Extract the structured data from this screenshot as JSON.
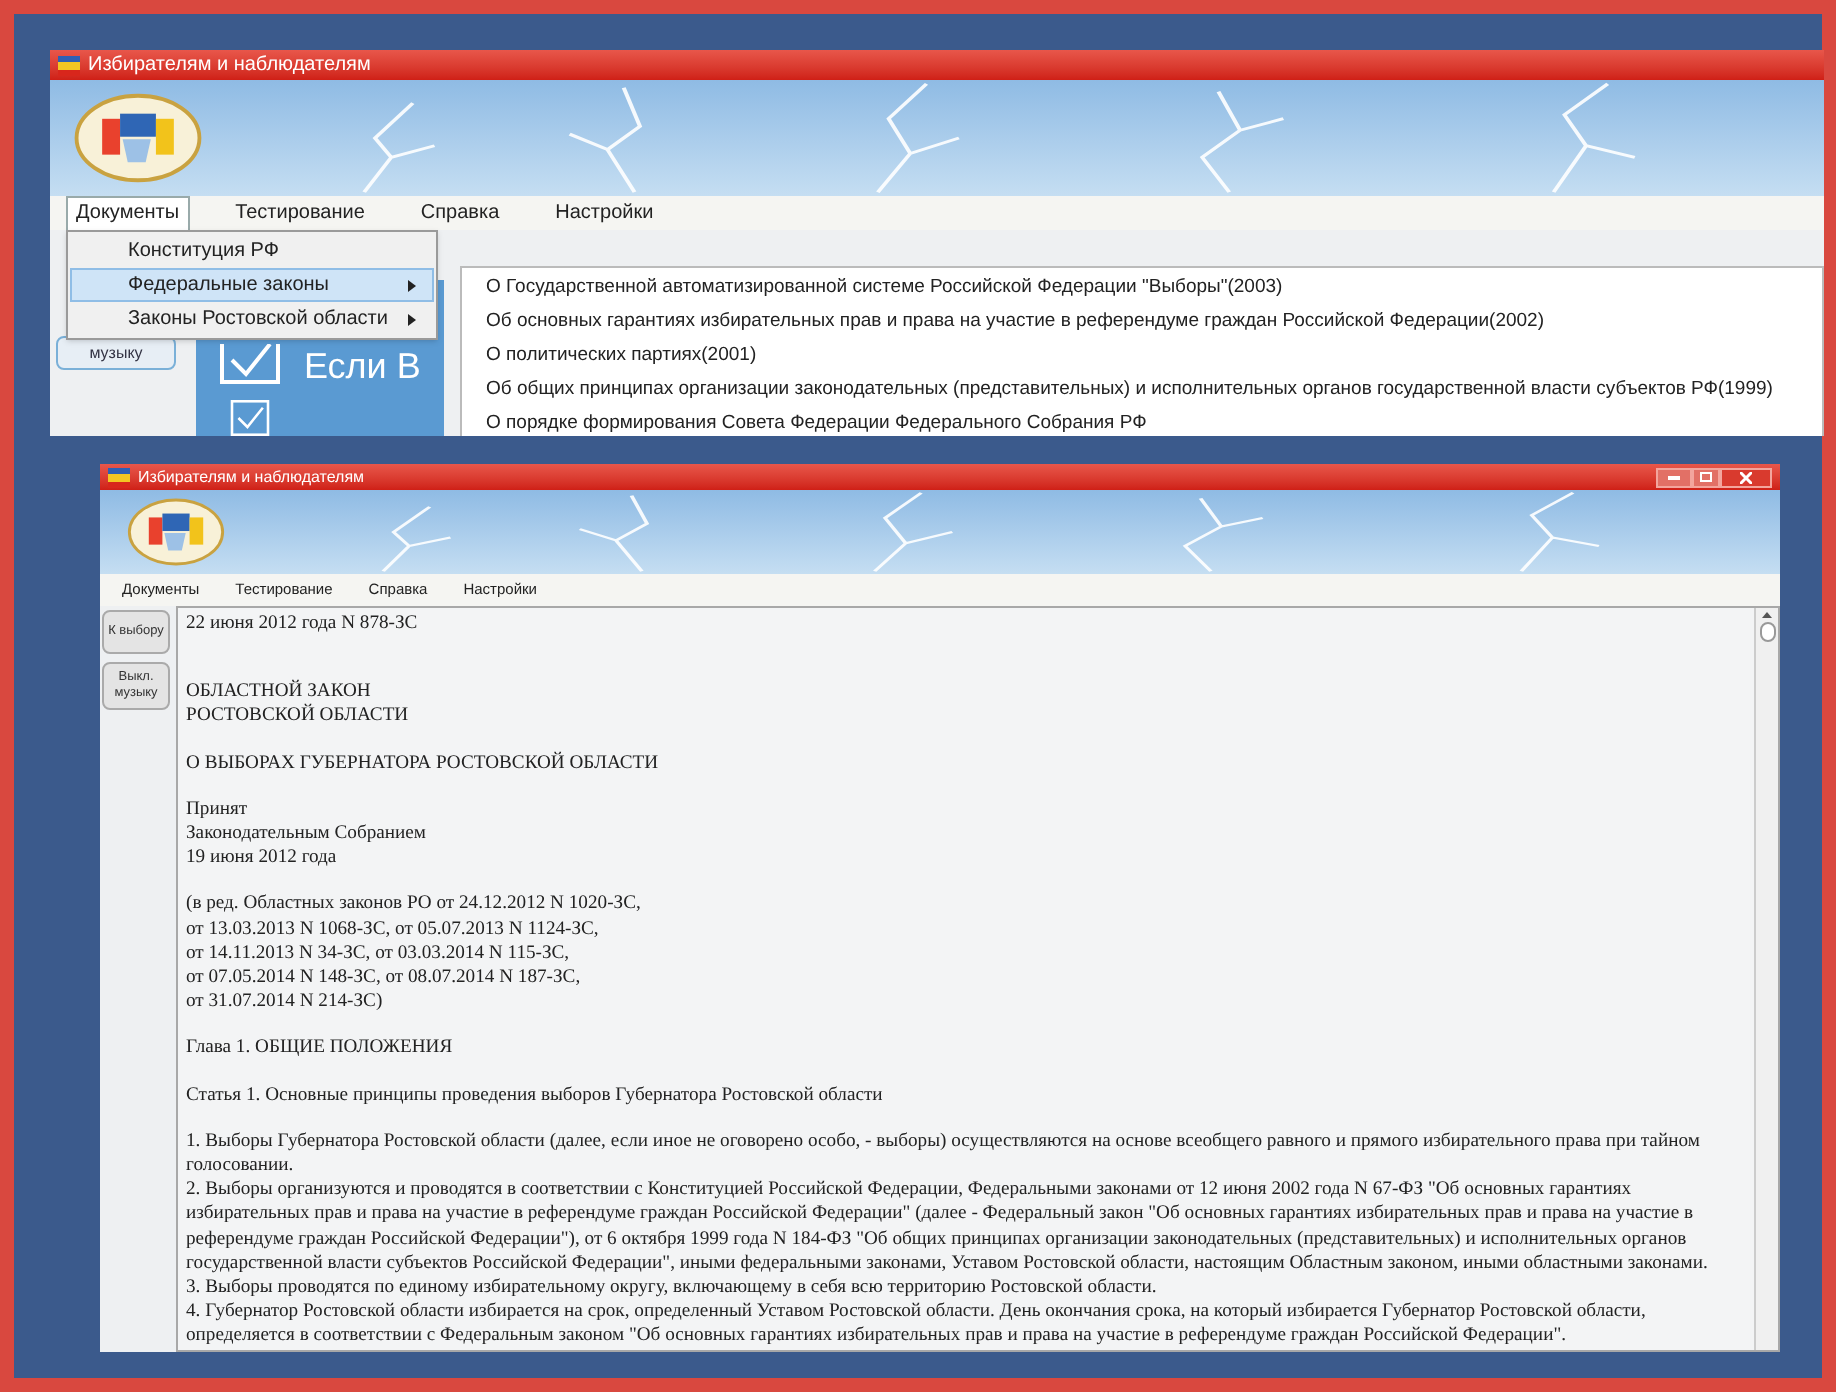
{
  "top_window": {
    "title": "Избирателям и наблюдателям",
    "menu": [
      {
        "label": "Документы",
        "selected": true
      },
      {
        "label": "Тестирование",
        "selected": false
      },
      {
        "label": "Справка",
        "selected": false
      },
      {
        "label": "Настройки",
        "selected": false
      }
    ],
    "side_button": "музыку",
    "panel_text": "Если В",
    "dropdown": [
      {
        "label": "Конституция РФ",
        "selected": false,
        "has_submenu": false
      },
      {
        "label": "Федеральные законы",
        "selected": true,
        "has_submenu": true
      },
      {
        "label": "Законы Ростовской области",
        "selected": false,
        "has_submenu": true
      }
    ],
    "submenu": [
      {
        "label": "О Государственной автоматизированной системе Российской Федерации \"Выборы\"(2003)",
        "selected": false
      },
      {
        "label": "Об основных гарантиях избирательных прав и права на участие в референдуме граждан Российской Федерации(2002)",
        "selected": false
      },
      {
        "label": "О политических партиях(2001)",
        "selected": false
      },
      {
        "label": "Об общих принципах организации законодательных (представительных) и исполнительных органов государственной власти субъектов РФ(1999)",
        "selected": false
      },
      {
        "label": "О порядке формирования Совета Федерации Федерального Собрания РФ",
        "selected": false
      }
    ]
  },
  "bottom_window": {
    "title": "Избирателям и наблюдателям",
    "menu": [
      {
        "label": "Документы",
        "selected": false
      },
      {
        "label": "Тестирование",
        "selected": false
      },
      {
        "label": "Справка",
        "selected": false
      },
      {
        "label": "Настройки",
        "selected": false
      }
    ],
    "side_buttons": [
      "К выбору",
      "Выкл. музыку"
    ],
    "document": [
      {
        "lines": [
          "22 июня 2012 года     N 878-ЗС"
        ]
      },
      {
        "lines": [
          "ОБЛАСТНОЙ ЗАКОН",
          "РОСТОВСКОЙ ОБЛАСТИ"
        ]
      },
      {
        "lines": [
          "О ВЫБОРАХ ГУБЕРНАТОРА РОСТОВСКОЙ ОБЛАСТИ"
        ]
      },
      {
        "lines": [
          "Принят",
          "Законодательным Собранием",
          "19 июня 2012 года"
        ]
      },
      {
        "lines": [
          "(в ред. Областных законов РО от 24.12.2012 N 1020-ЗС,",
          "от 13.03.2013 N 1068-ЗС, от 05.07.2013 N 1124-ЗС,",
          "от 14.11.2013 N 34-ЗС, от 03.03.2014 N 115-ЗС,",
          "от 07.05.2014 N 148-ЗС, от 08.07.2014 N 187-ЗС,",
          "от 31.07.2014 N 214-ЗС)"
        ]
      },
      {
        "lines": [
          "Глава 1. ОБЩИЕ ПОЛОЖЕНИЯ"
        ]
      },
      {
        "lines": [
          "Статья 1. Основные принципы проведения выборов Губернатора Ростовской области"
        ]
      },
      {
        "lines": [
          "1. Выборы Губернатора Ростовской области (далее, если иное не оговорено особо, - выборы) осуществляются на основе всеобщего равного и прямого избирательного права при тайном",
          "голосовании.",
          "2. Выборы организуются и проводятся в соответствии с Конституцией Российской Федерации, Федеральными законами от 12 июня 2002 года N 67-ФЗ \"Об основных гарантиях",
          "избирательных прав и права на участие в референдуме граждан Российской Федерации\" (далее - Федеральный закон \"Об основных гарантиях избирательных прав и права на участие в",
          "референдуме граждан Российской Федерации\"), от 6 октября 1999 года N 184-ФЗ \"Об общих принципах организации законодательных (представительных) и исполнительных органов",
          "государственной власти субъектов Российской Федерации\", иными федеральными законами, Уставом Ростовской области, настоящим Областным законом, иными областными законами.",
          "3. Выборы проводятся по единому избирательному округу, включающему в себя всю территорию Ростовской области.",
          "4. Губернатор Ростовской области избирается на срок, определенный Уставом Ростовской области. День окончания срока, на который избирается Губернатор Ростовской области,",
          "определяется в соответствии с Федеральным законом \"Об основных гарантиях избирательных прав и права на участие в референдуме граждан Российской Федерации\"."
        ]
      }
    ]
  }
}
